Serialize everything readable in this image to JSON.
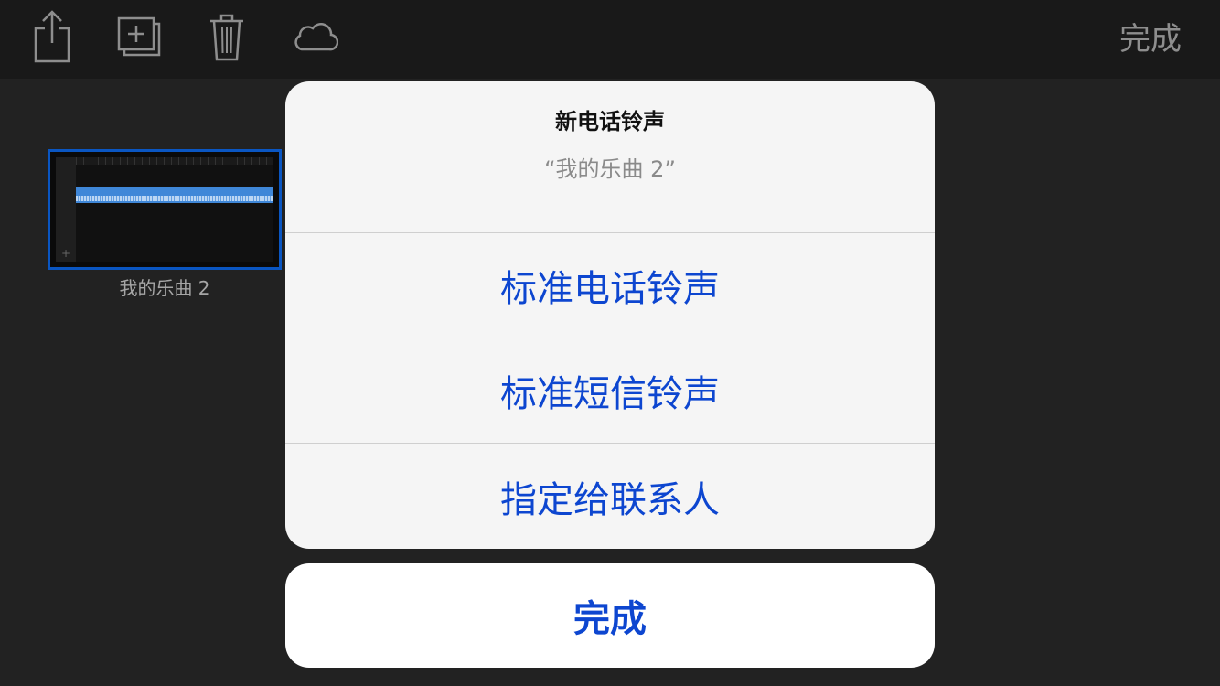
{
  "toolbar": {
    "icons": [
      "share-icon",
      "duplicate-icon",
      "trash-icon",
      "cloud-icon"
    ],
    "done_label": "完成"
  },
  "project": {
    "name": "我的乐曲 2"
  },
  "action_sheet": {
    "title": "新电话铃声",
    "message": "“我的乐曲 2”",
    "items": [
      {
        "label": "标准电话铃声"
      },
      {
        "label": "标准短信铃声"
      },
      {
        "label": "指定给联系人"
      }
    ],
    "cancel_label": "完成"
  },
  "colors": {
    "accent": "#0d46d0",
    "background": "#222222",
    "toolbar": "#191919",
    "sheet": "#f5f5f5",
    "selection_border": "#0a56c2"
  }
}
